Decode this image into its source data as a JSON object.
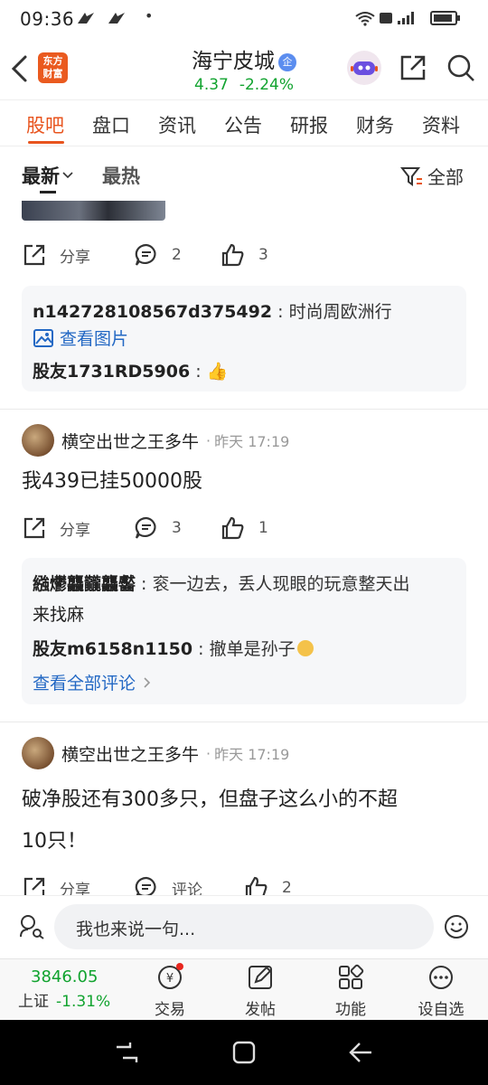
{
  "status_bar": {
    "time": "09:36",
    "dot": "•"
  },
  "header": {
    "logo_line1": "东方",
    "logo_line2": "财富",
    "stock_name": "海宁皮城",
    "badge": "企",
    "price": "4.37",
    "change": "-2.24%"
  },
  "tabs": [
    "股吧",
    "盘口",
    "资讯",
    "公告",
    "研报",
    "财务",
    "资料"
  ],
  "sort": {
    "latest": "最新",
    "hottest": "最热",
    "filter": "全部"
  },
  "post0": {
    "share": "分享",
    "comments": "2",
    "likes": "3",
    "reply1_user": "n142728108567d375492",
    "reply1_text": "时尚周欧洲行",
    "reply1_link": "查看图片",
    "reply2_user": "股友1731RD5906",
    "reply2_emoji": "👍"
  },
  "post1": {
    "author": "横空出世之王多牛",
    "time": "昨天 17:19",
    "content": "我439已挂50000股",
    "share": "分享",
    "comments": "3",
    "likes": "1",
    "reply1_user": "繈爩龘龖龘齾",
    "reply1_text_line1": "衮一边去，丢人现眼的玩意整天出",
    "reply1_text_line2": "来找麻",
    "reply2_user": "股友m6158n1150",
    "reply2_text": "撤单是孙子",
    "view_all": "查看全部评论"
  },
  "post2": {
    "author": "横空出世之王多牛",
    "time": "昨天 17:19",
    "content_line1": "破净股还有300多只，但盘子这么小的不超",
    "content_line2": "10只！",
    "share": "分享",
    "comment": "评论",
    "likes": "2"
  },
  "input": {
    "placeholder": "我也来说一句..."
  },
  "bottom_nav": {
    "index_value": "3846.05",
    "index_name": "上证",
    "index_change": "-1.31%",
    "trade": "交易",
    "post": "发帖",
    "features": "功能",
    "watchlist": "设自选"
  },
  "colors": {
    "accent": "#e8541e",
    "up_green": "#11a32f",
    "link": "#2368c4"
  }
}
